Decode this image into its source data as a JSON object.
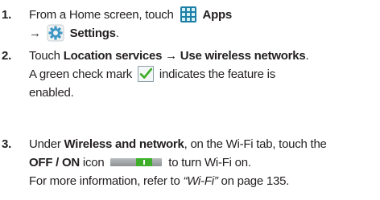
{
  "steps": [
    {
      "number": "1.",
      "line1_pre": "From a Home screen, touch",
      "line1_bold": "Apps",
      "arrow": "→",
      "line2_bold": "Settings",
      "line2_post": "."
    },
    {
      "number": "2.",
      "pre": "Touch",
      "bold1": "Location services",
      "arrow": "→",
      "bold2": "Use wireless networks",
      "post": ".",
      "line2_pre": "A green check mark",
      "line2_post": "indicates the feature is",
      "line3": "enabled."
    },
    {
      "number": "3.",
      "pre": "Under",
      "bold1": "Wireless and network",
      "mid": ", on the Wi-Fi tab, touch the",
      "bold2": "OFF / ON",
      "line2_post": "icon",
      "line2_end": "to turn Wi-Fi on.",
      "line3_pre": "For more information, refer to",
      "line3_ref": "“Wi-Fi”",
      "line3_post": "on page 135."
    }
  ],
  "icons": {
    "apps": "apps-grid-icon",
    "settings": "gear-icon",
    "check": "green-checkmark-icon",
    "toggle": "off-on-toggle-icon"
  },
  "colors": {
    "text": "#231f20",
    "apps_blue": "#1e7fa6",
    "check_green": "#3fae2a"
  }
}
